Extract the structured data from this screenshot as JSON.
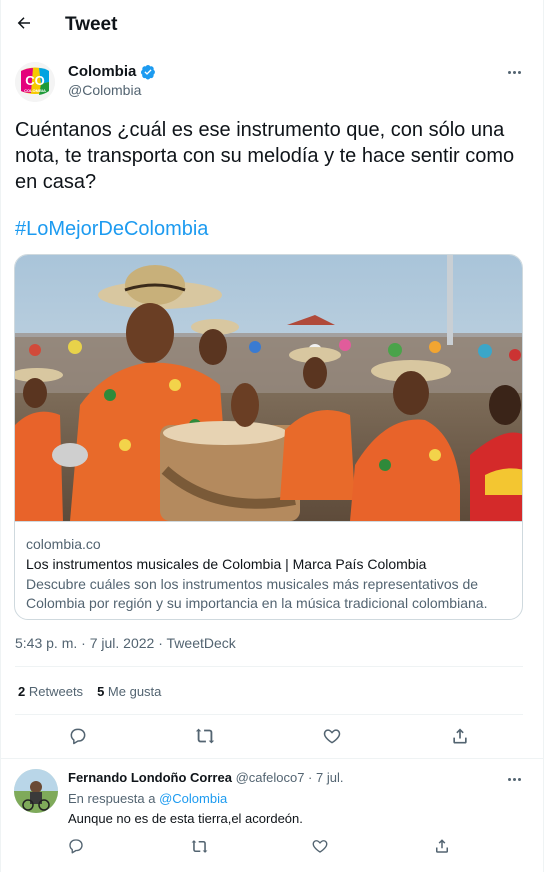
{
  "header": {
    "title": "Tweet"
  },
  "tweet": {
    "author_name": "Colombia",
    "author_handle": "@Colombia",
    "avatar_text": "CO",
    "avatar_subtext": "COLOMBIA",
    "text": "Cuéntanos ¿cuál es ese instrumento que, con sólo una nota, te transporta con su melodía y te hace sentir como en casa?",
    "hashtag": "#LoMejorDeColombia",
    "timestamp": "5:43 p. m. · 7 jul. 2022",
    "source": "TweetDeck",
    "separator": " · "
  },
  "card": {
    "domain": "colombia.co",
    "title": "Los instrumentos musicales de Colombia | Marca País Colombia",
    "description": "Descubre cuáles son los instrumentos musicales más representativos de Colombia por región y su importancia en la música tradicional colombiana."
  },
  "stats": {
    "retweets_count": "2",
    "retweets_label": "Retweets",
    "likes_count": "5",
    "likes_label": "Me gusta"
  },
  "icons": {
    "back": "arrow-left-icon",
    "verified": "verified-badge-icon",
    "more": "more-horizontal-icon",
    "reply": "reply-icon",
    "retweet": "retweet-icon",
    "like": "heart-icon",
    "share": "share-icon"
  },
  "colors": {
    "accent": "#1d9bf0",
    "secondary_text": "#536471",
    "border": "#cfd9de"
  },
  "reply": {
    "name": "Fernando Londoño Correa",
    "handle": "@cafeloco7",
    "date": "7 jul.",
    "dot": " · ",
    "in_reply_prefix": "En respuesta a",
    "in_reply_mention": "@Colombia",
    "text": "Aunque no es de esta tierra,el acordeón."
  }
}
